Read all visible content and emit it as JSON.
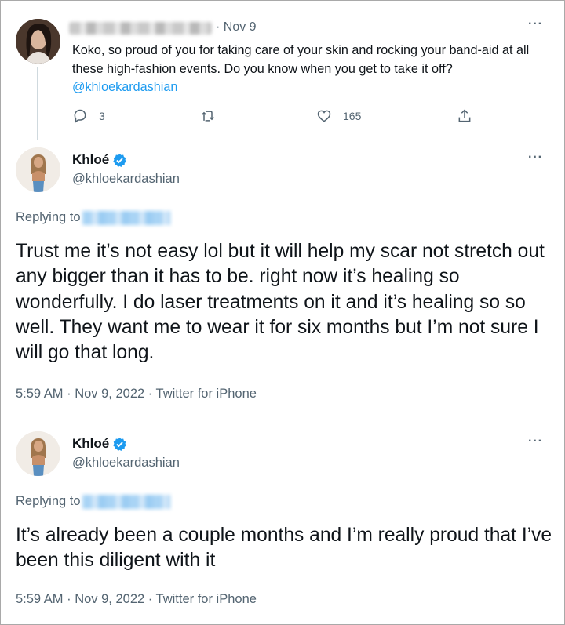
{
  "context_tweet": {
    "date": "· Nov 9",
    "more": "···",
    "text": "Koko, so proud of you for taking care of your skin and rocking your band-aid at all these high-fashion events. Do you know when you get to take it off?",
    "mention": "@khloekardashian",
    "replies": "3",
    "likes": "165"
  },
  "tweets": [
    {
      "name": "Khloé",
      "handle": "@khloekardashian",
      "more": "···",
      "replying_label": "Replying to",
      "text": "Trust me it’s not easy lol but it will help my scar not stretch out any bigger than it has to be. right now it’s healing so wonderfully. I do laser treatments on it and it’s healing so so well. They want me to wear it for six months but I’m not sure I will go that long.",
      "meta": "5:59 AM · Nov 9, 2022 · Twitter for iPhone"
    },
    {
      "name": "Khloé",
      "handle": "@khloekardashian",
      "more": "···",
      "replying_label": "Replying to",
      "text": "It’s already been a couple months and I’m really proud that I’ve been this diligent with it",
      "meta": "5:59 AM · Nov 9, 2022 · Twitter for iPhone"
    }
  ],
  "icons": {
    "reply": "reply-icon",
    "retweet": "retweet-icon",
    "like": "heart-icon",
    "share": "share-icon",
    "verified": "verified-badge-icon"
  },
  "colors": {
    "accent": "#1d9bf0",
    "secondary_text": "#536471",
    "primary_text": "#0f1419"
  }
}
